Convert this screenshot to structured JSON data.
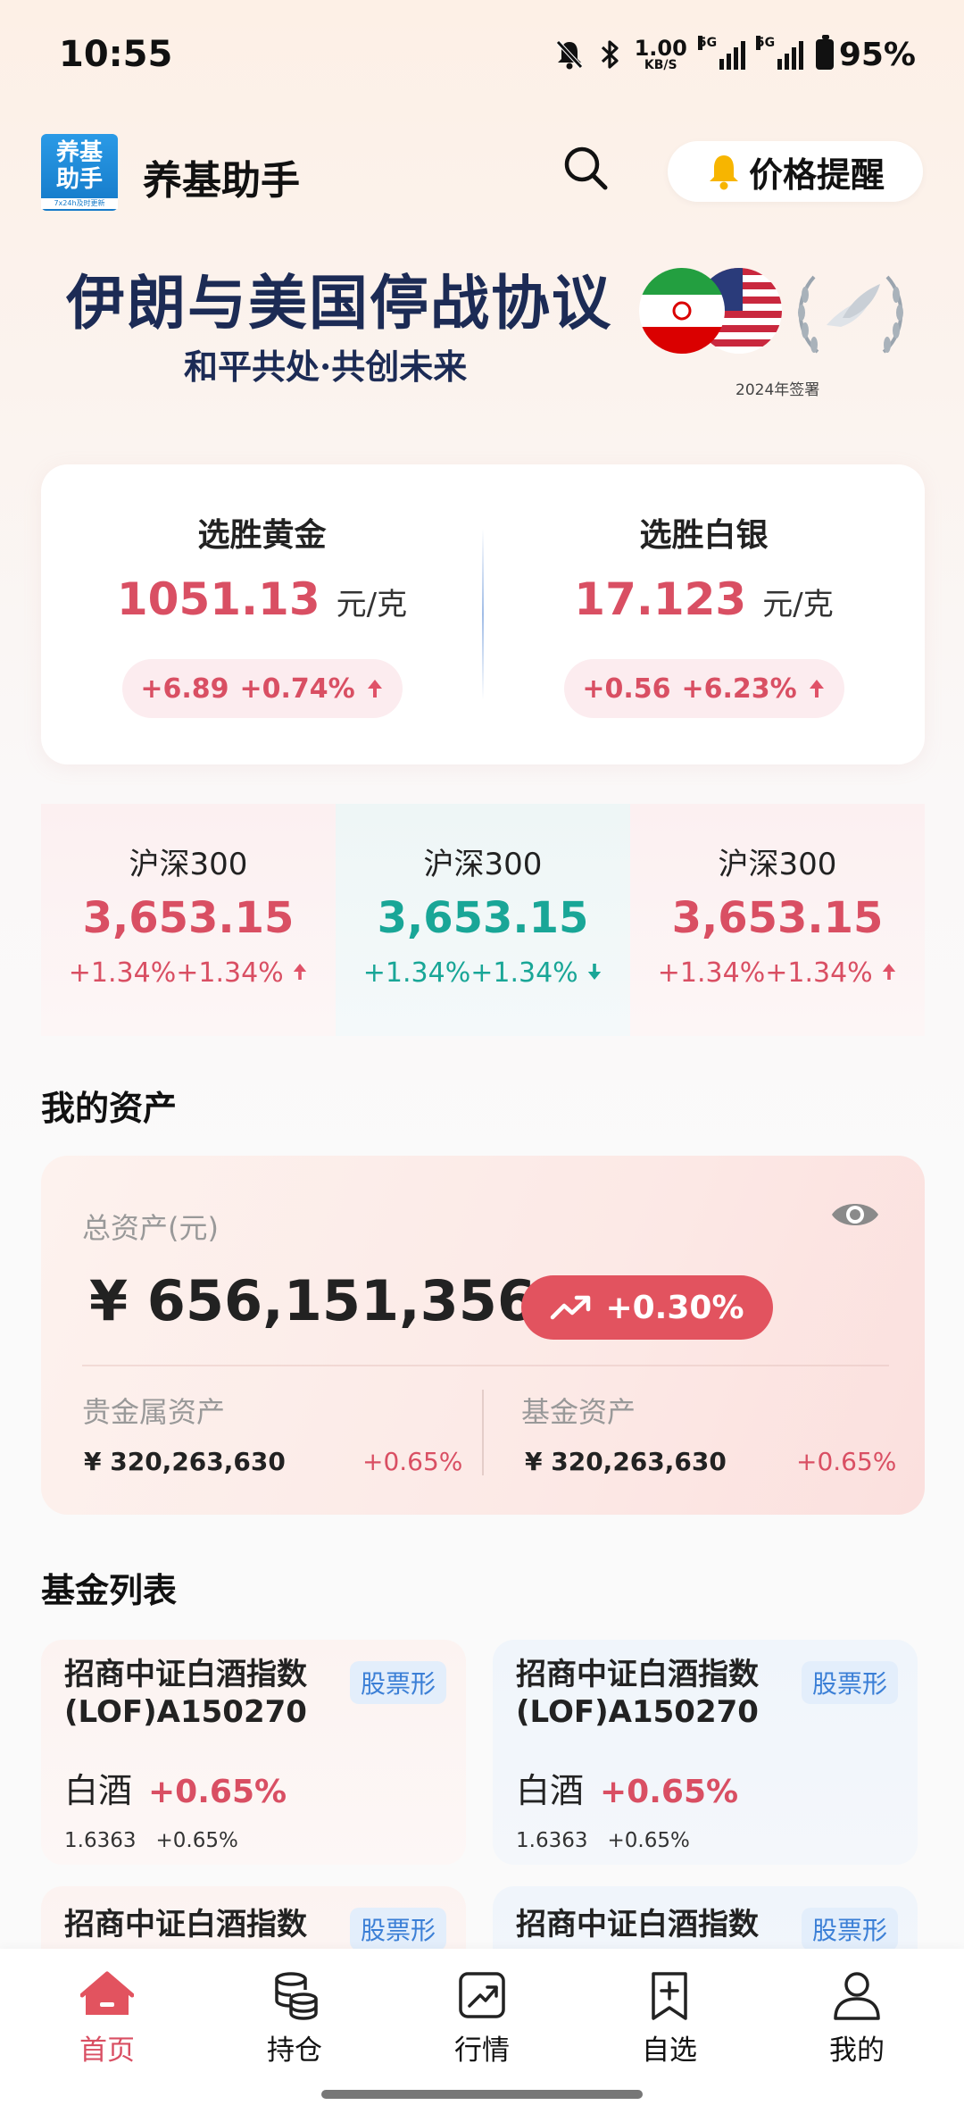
{
  "status": {
    "time": "10:55",
    "speed_value": "1.00",
    "speed_unit": "KB/S",
    "sig1": "5G",
    "sig2": "5G",
    "battery": "95%"
  },
  "header": {
    "title": "养基助手",
    "logo_line1": "养基",
    "logo_line2": "助手",
    "logo_tagline": "7x24h及时更新",
    "price_alert": "价格提醒"
  },
  "banner": {
    "title": "伊朗与美国停战协议",
    "subtitle": "和平共处·共创未来",
    "year": "2024年签署"
  },
  "metals": [
    {
      "name": "选胜黄金",
      "price": "1051.13",
      "unit": "元/克",
      "change": "+6.89",
      "pct": "+0.74%"
    },
    {
      "name": "选胜白银",
      "price": "17.123",
      "unit": "元/克",
      "change": "+0.56",
      "pct": "+6.23%"
    }
  ],
  "indices": [
    {
      "name": "沪深300",
      "value": "3,653.15",
      "change": "+1.34%+1.34%",
      "direction": "up"
    },
    {
      "name": "沪深300",
      "value": "3,653.15",
      "change": "+1.34%+1.34%",
      "direction": "down"
    },
    {
      "name": "沪深300",
      "value": "3,653.15",
      "change": "+1.34%+1.34%",
      "direction": "up"
    }
  ],
  "assets": {
    "section_title": "我的资产",
    "total_label": "总资产(元)",
    "total_value": "¥ 656,151,356",
    "total_change": "+0.30%",
    "metal_label": "贵金属资产",
    "metal_value": "¥ 320,263,630",
    "metal_pct": "+0.65%",
    "fund_label": "基金资产",
    "fund_value": "¥ 320,263,630",
    "fund_pct": "+0.65%"
  },
  "funds": {
    "section_title": "基金列表",
    "items": [
      {
        "name": "招商中证白酒指数(LOF)A150270",
        "tag": "股票形",
        "category": "白酒",
        "pct": "+0.65%",
        "nav": "1.6363",
        "nav_pct": "+0.65%"
      },
      {
        "name": "招商中证白酒指数(LOF)A150270",
        "tag": "股票形",
        "category": "白酒",
        "pct": "+0.65%",
        "nav": "1.6363",
        "nav_pct": "+0.65%"
      },
      {
        "name": "招商中证白酒指数",
        "tag": "股票形"
      },
      {
        "name": "招商中证白酒指数",
        "tag": "股票形"
      }
    ]
  },
  "nav": [
    {
      "label": "首页",
      "icon": "home-icon"
    },
    {
      "label": "持仓",
      "icon": "coins-icon"
    },
    {
      "label": "行情",
      "icon": "chart-icon"
    },
    {
      "label": "自选",
      "icon": "bookmark-add-icon"
    },
    {
      "label": "我的",
      "icon": "user-icon"
    }
  ],
  "colors": {
    "up": "#d94f63",
    "down": "#19a697",
    "accent": "#e2535f",
    "banner_text": "#1c2b55"
  }
}
